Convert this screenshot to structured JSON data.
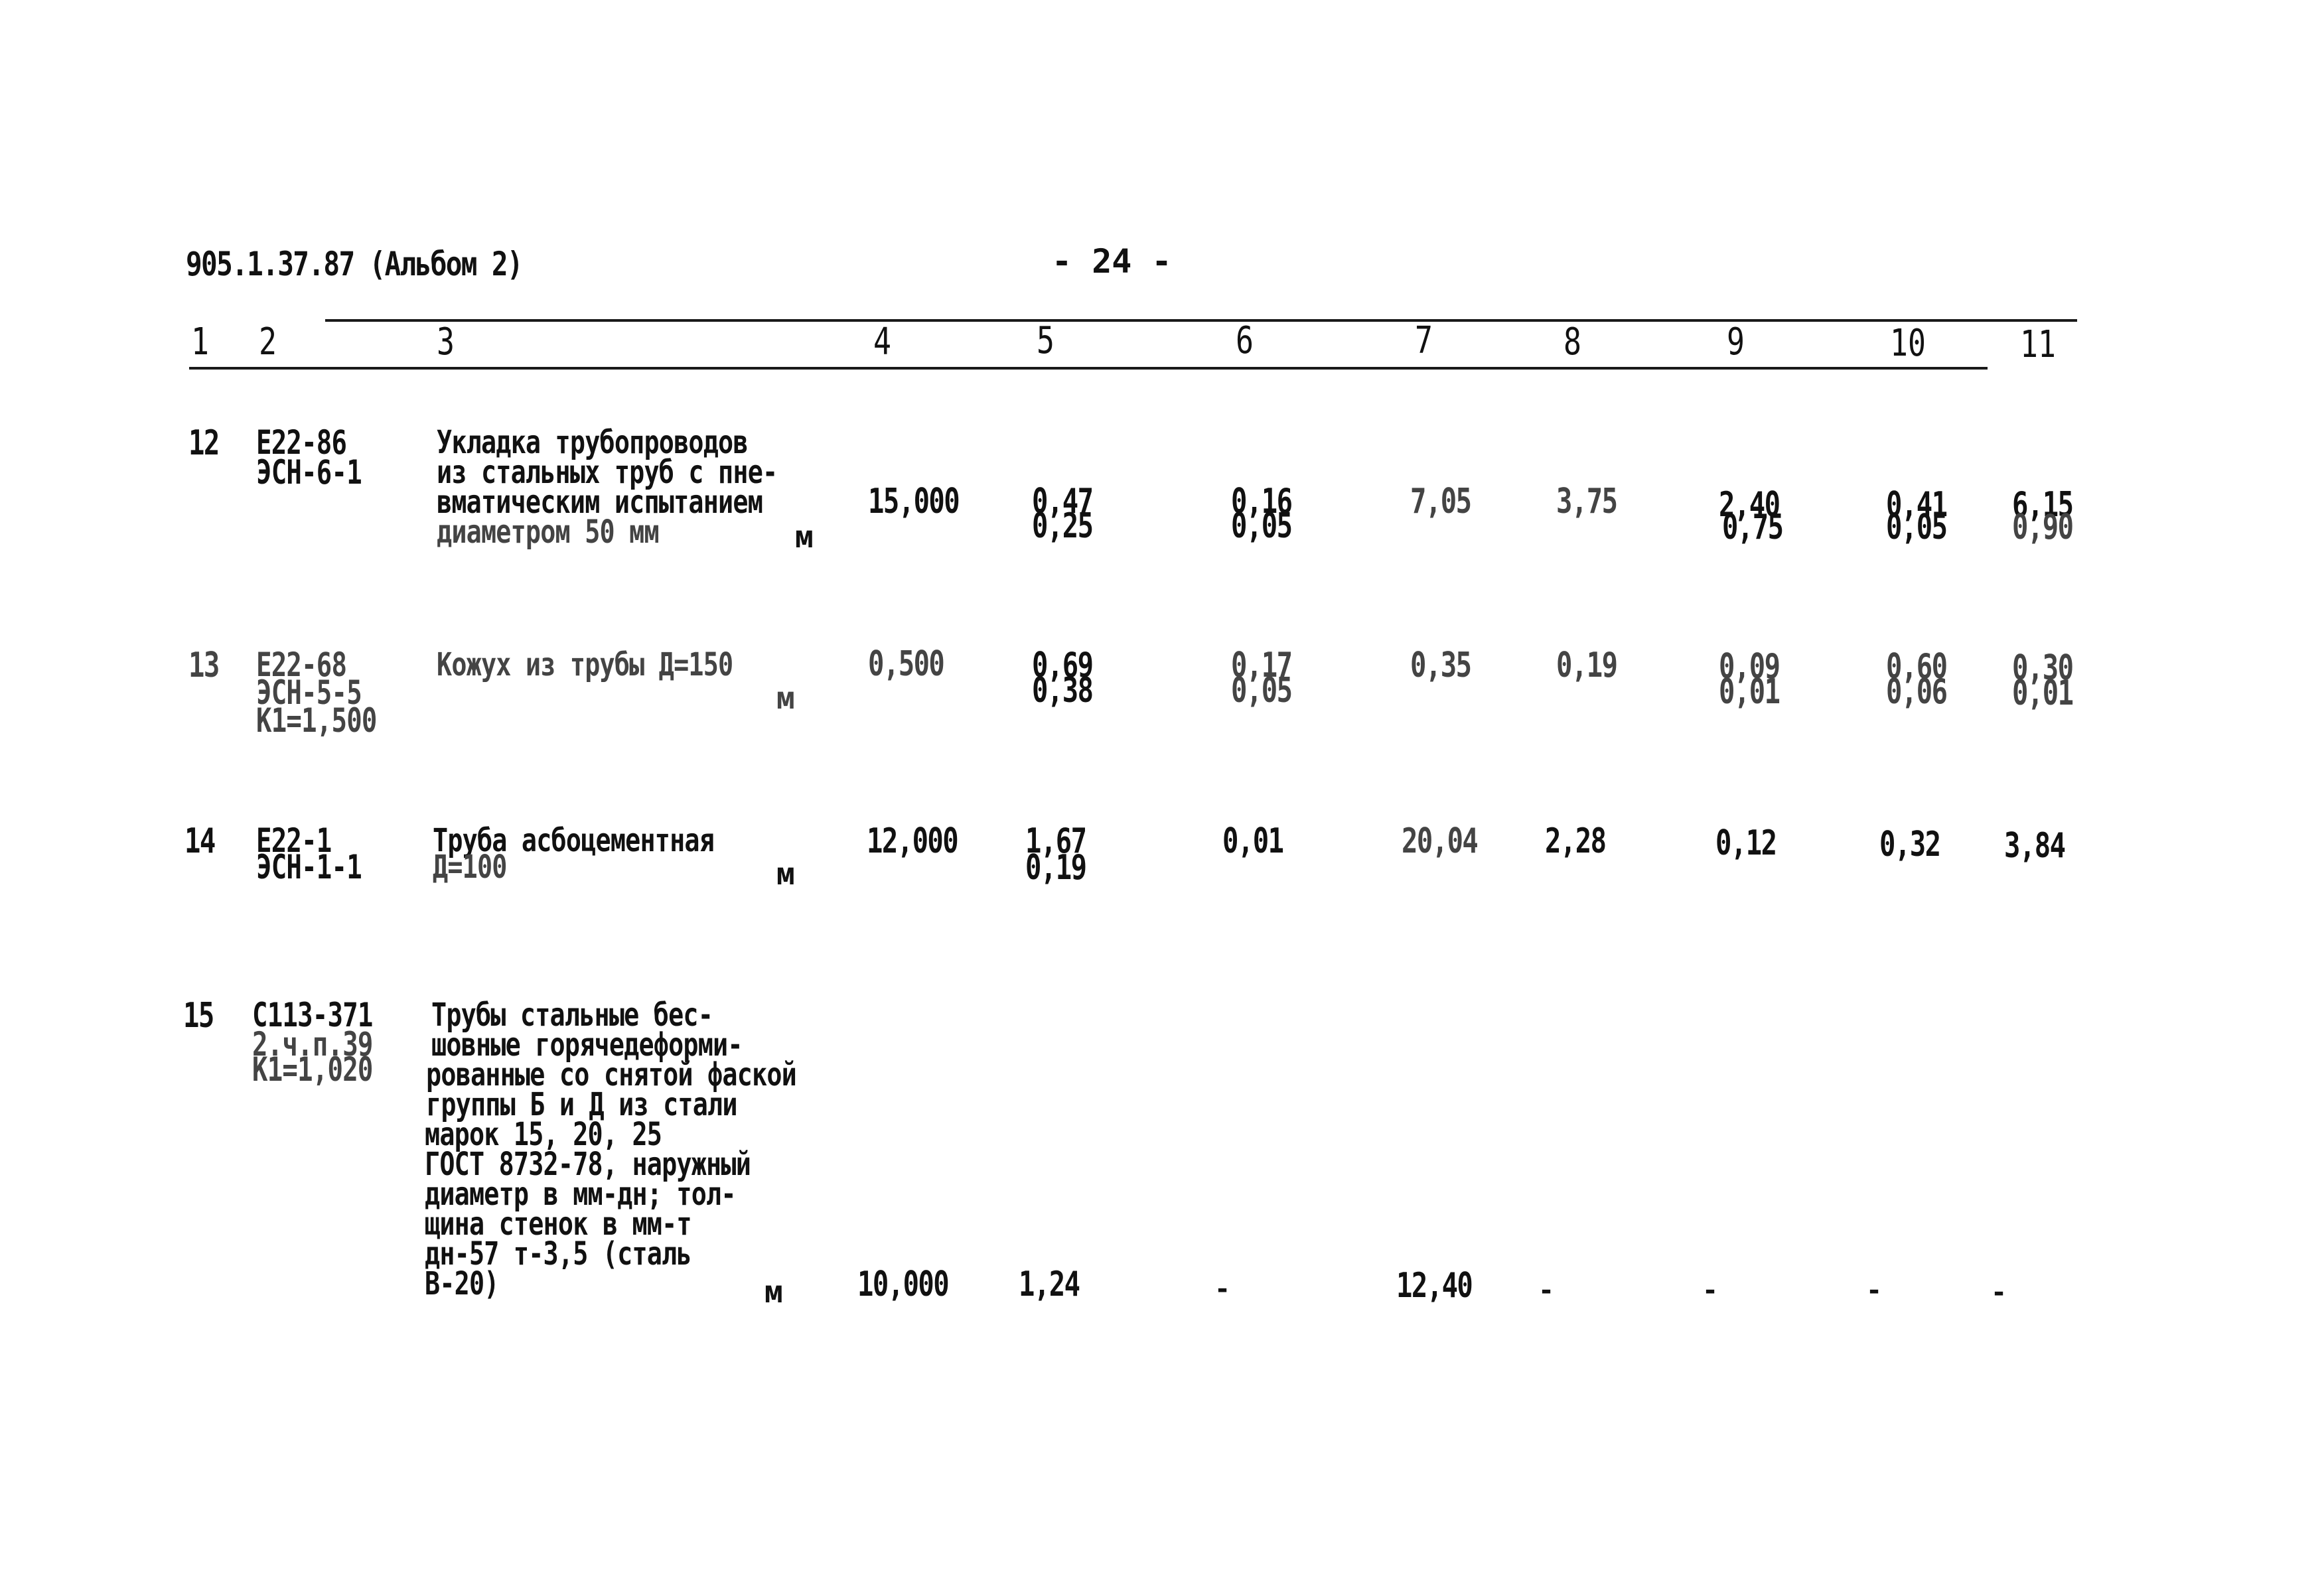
{
  "header": {
    "doc_code": "905.1.37.87 (Альбом 2)",
    "page_number": "- 24 -"
  },
  "columns": [
    "1",
    "2",
    "3",
    "4",
    "5",
    "6",
    "7",
    "8",
    "9",
    "10",
    "11"
  ],
  "rows": [
    {
      "num": "12",
      "code": [
        "Е22-86",
        "ЭСН-6-1"
      ],
      "description": [
        "Укладка трубопроводов",
        "из стальных труб с пне-",
        "вматическим испытанием",
        "диаметром 50 мм"
      ],
      "unit": "м",
      "qty": "15,000",
      "c5": [
        "0,47",
        "0,25"
      ],
      "c6": [
        "0,16",
        "0,05"
      ],
      "c7": [
        "7,05"
      ],
      "c8": [
        "3,75"
      ],
      "c9": [
        "2,40",
        "0,75"
      ],
      "c10": [
        "0,41",
        "0,05"
      ],
      "c11": [
        "6,15",
        "0,90"
      ]
    },
    {
      "num": "13",
      "code": [
        "Е22-68",
        "ЭСН-5-5",
        "К1=1,500"
      ],
      "description": [
        "Кожух из трубы Д=150"
      ],
      "unit": "м",
      "qty": "0,500",
      "c5": [
        "0,69",
        "0,38"
      ],
      "c6": [
        "0,17",
        "0,05"
      ],
      "c7": [
        "0,35"
      ],
      "c8": [
        "0,19"
      ],
      "c9": [
        "0,09",
        "0,01"
      ],
      "c10": [
        "0,60",
        "0,06"
      ],
      "c11": [
        "0,30",
        "0,01"
      ]
    },
    {
      "num": "14",
      "code": [
        "Е22-1",
        "ЭСН-1-1"
      ],
      "description": [
        "Труба асбоцементная",
        "Д=100"
      ],
      "unit": "м",
      "qty": "12,000",
      "c5": [
        "1,67",
        "0,19"
      ],
      "c6": [
        "0,01"
      ],
      "c7": [
        "20,04"
      ],
      "c8": [
        "2,28"
      ],
      "c9": [
        "0,12"
      ],
      "c10": [
        "0,32"
      ],
      "c11": [
        "3,84"
      ]
    },
    {
      "num": "15",
      "code": [
        "С113-371",
        "2.ч.п.39",
        "К1=1,020"
      ],
      "description": [
        "Трубы стальные бес-",
        "шовные горячедеформи-",
        "рованные со снятой фаской",
        "группы Б и Д из стали",
        "марок 15, 20, 25",
        "ГОСТ 8732-78, наружный",
        "диаметр в мм-дн; тол-",
        "щина стенок в мм-т",
        "дн-57 т-3,5 (сталь",
        "В-20)"
      ],
      "unit": "м",
      "qty": "10,000",
      "c5": [
        "1,24"
      ],
      "c6": [
        "-"
      ],
      "c7": [
        "12,40"
      ],
      "c8": [
        "-"
      ],
      "c9": [
        "-"
      ],
      "c10": [
        "-"
      ],
      "c11": [
        "-"
      ]
    }
  ]
}
